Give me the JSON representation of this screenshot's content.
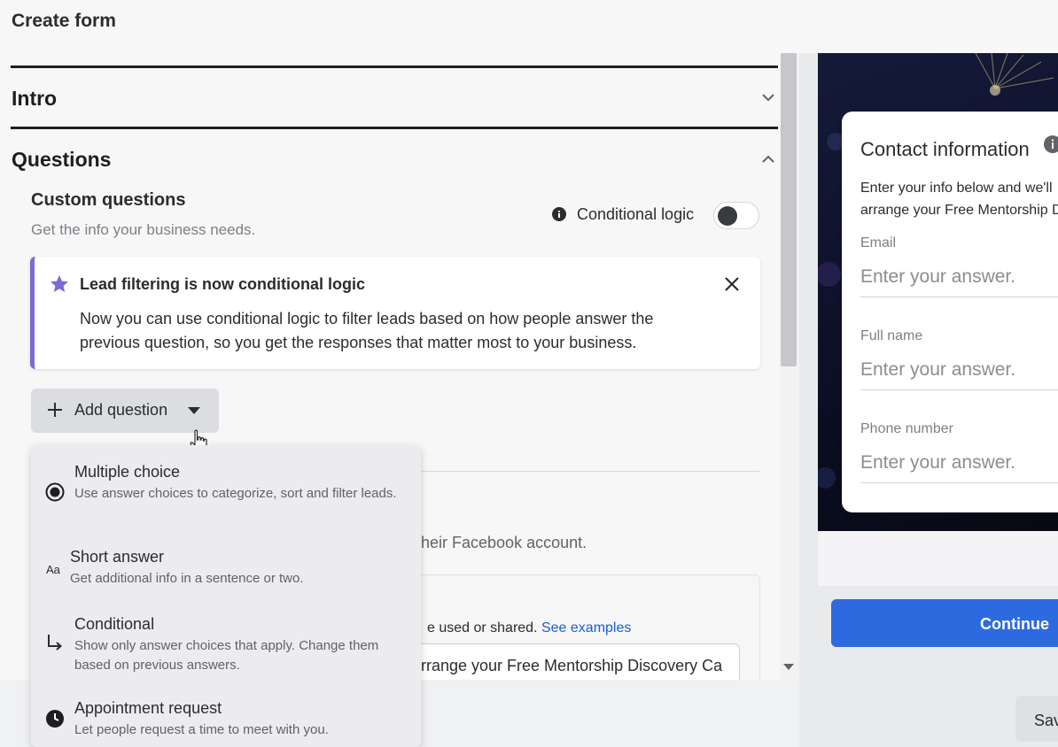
{
  "header": {
    "title": "Create form"
  },
  "sections": {
    "intro": {
      "title": "Intro"
    },
    "questions": {
      "title": "Questions"
    }
  },
  "custom_questions": {
    "title": "Custom questions",
    "subtitle": "Get the info your business needs.",
    "conditional_logic_label": "Conditional logic",
    "conditional_logic_enabled": false
  },
  "notice": {
    "title": "Lead filtering is now conditional logic",
    "body": "Now you can use conditional logic to filter leads based on how people answer the previous question, so you get the responses that matter most to your business.",
    "accent_color": "#7b6ad1"
  },
  "add_question": {
    "label": "Add question"
  },
  "question_menu": [
    {
      "icon": "radio-button-icon",
      "title": "Multiple choice",
      "desc": "Use answer choices to categorize, sort and filter leads."
    },
    {
      "icon": "text-aa-icon",
      "title": "Short answer",
      "desc": "Get additional info in a sentence or two."
    },
    {
      "icon": "branch-arrow-icon",
      "title": "Conditional",
      "desc": "Show only answer choices that apply. Change them based on previous answers."
    },
    {
      "icon": "clock-icon",
      "title": "Appointment request",
      "desc": "Let people request a time to meet with you."
    }
  ],
  "background_content": {
    "facebook_text": "their Facebook account.",
    "used_shared_text": "e used or shared.",
    "see_examples_link": "See examples",
    "input_value": "rrange your Free Mentorship Discovery Ca"
  },
  "preview": {
    "card_title": "Contact information",
    "card_text_line1": "Enter your info below and we'll",
    "card_text_line2": "arrange your Free Mentorship D",
    "fields": [
      {
        "label": "Email",
        "placeholder": "Enter your answer."
      },
      {
        "label": "Full name",
        "placeholder": "Enter your answer."
      },
      {
        "label": "Phone number",
        "placeholder": "Enter your answer."
      }
    ],
    "continue_label": "Continue",
    "button_color": "#2d6ae0"
  },
  "footer": {
    "save_label": "Save"
  }
}
